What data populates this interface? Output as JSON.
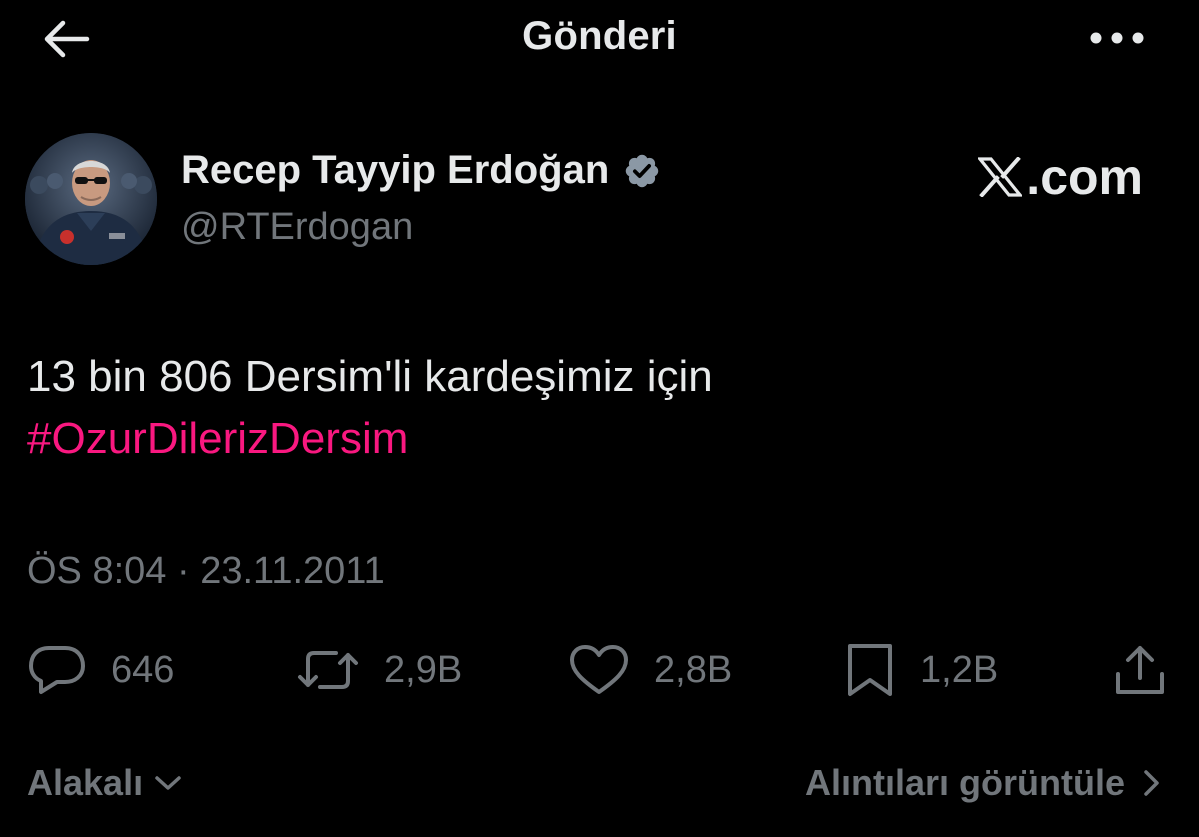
{
  "header": {
    "title": "Gönderi",
    "back_icon": "arrow-left-icon",
    "more_icon": "more-horizontal-icon"
  },
  "author": {
    "name": "Recep Tayyip Erdoğan",
    "handle": "@RTErdogan",
    "verified_icon": "verified-badge-icon",
    "verified_color": "#8b98a5"
  },
  "watermark": {
    "text": ".com",
    "logo_icon": "x-logo-icon"
  },
  "tweet": {
    "text": "13 bin 806 Dersim'li kardeşimiz için",
    "hashtag": "#OzurDilerizDersim",
    "hashtag_color": "#f91880",
    "timestamp": "ÖS 8:04 · 23.11.2011"
  },
  "actions": {
    "replies": "646",
    "retweets": "2,9B",
    "likes": "2,8B",
    "bookmarks": "1,2B",
    "reply_icon": "reply-icon",
    "retweet_icon": "retweet-icon",
    "like_icon": "heart-icon",
    "bookmark_icon": "bookmark-icon",
    "share_icon": "share-icon"
  },
  "footer": {
    "sort_label": "Alakalı",
    "sort_icon": "chevron-down-icon",
    "quotes_label": "Alıntıları görüntüle",
    "quotes_icon": "chevron-right-icon"
  },
  "colors": {
    "background": "#000000",
    "text_primary": "#e7e9ea",
    "text_secondary": "#71767b"
  }
}
